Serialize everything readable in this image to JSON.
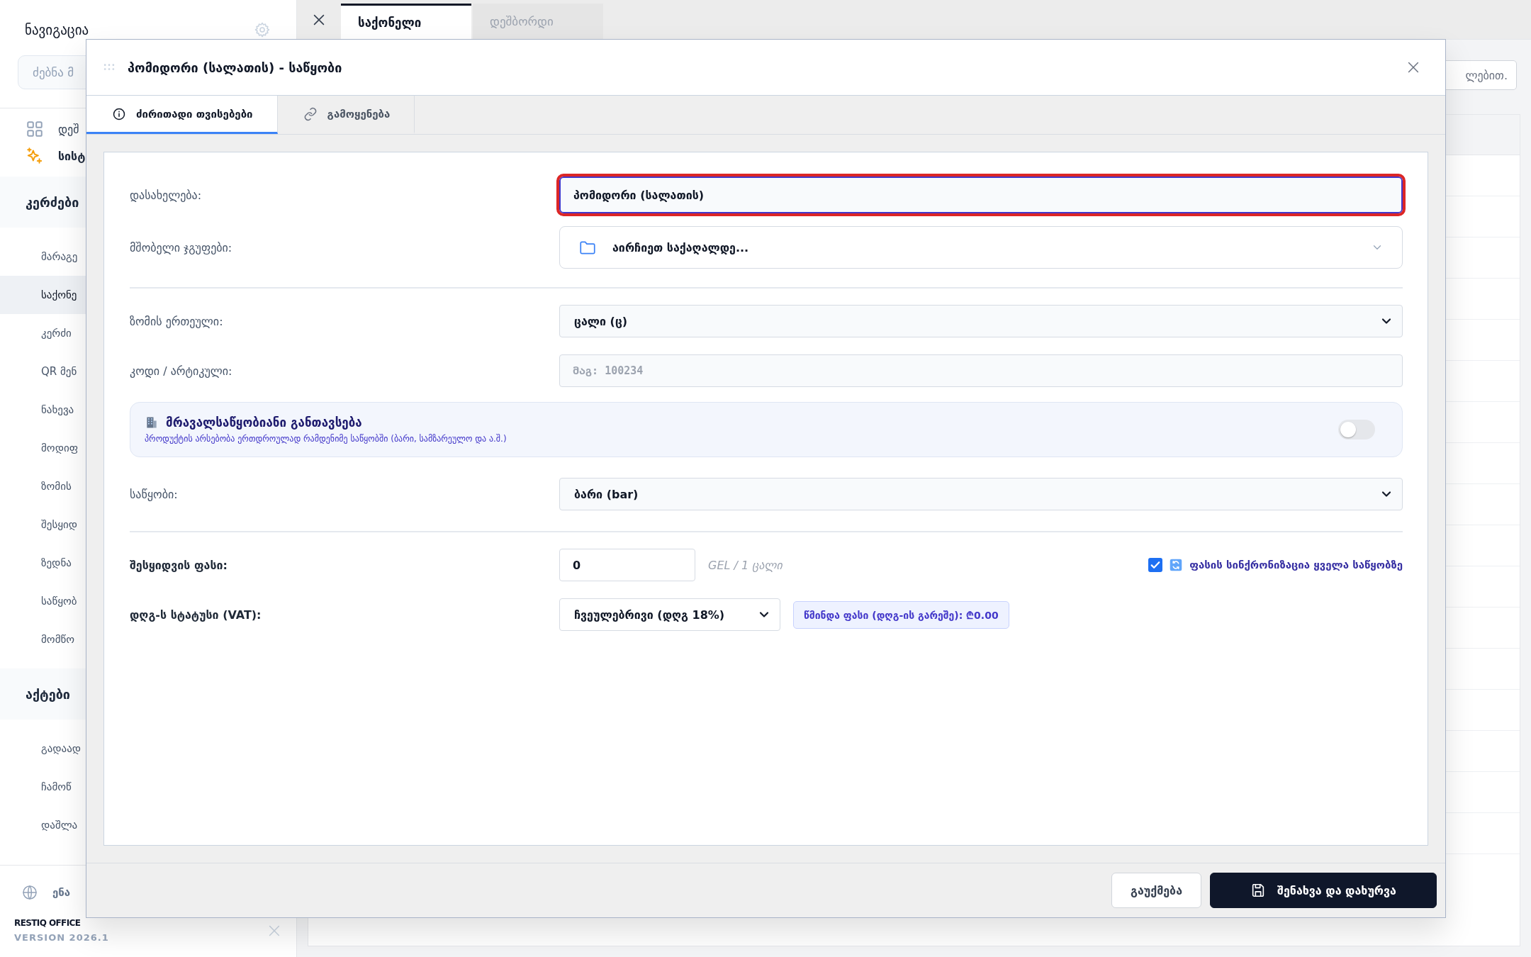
{
  "sidebar": {
    "title": "ნავიგაცია",
    "search": {
      "placeholder": "ძებნა მ"
    },
    "top_items": [
      {
        "label": "დეშ"
      },
      {
        "label": "სისტ"
      }
    ],
    "sections": [
      {
        "title": "კერძები",
        "items": [
          {
            "label": "მარაგე",
            "selected": false
          },
          {
            "label": "საქონე",
            "selected": true
          },
          {
            "label": "კერძი",
            "selected": false
          },
          {
            "label": "QR მენ",
            "selected": false
          },
          {
            "label": "ნახევა",
            "selected": false
          },
          {
            "label": "მოდიფ",
            "selected": false
          },
          {
            "label": "ზომის",
            "selected": false
          },
          {
            "label": "შესყიდ",
            "selected": false
          },
          {
            "label": "ზედნა",
            "selected": false
          },
          {
            "label": "საწყობ",
            "selected": false
          },
          {
            "label": "მომწო",
            "selected": false
          }
        ]
      },
      {
        "title": "აქტები",
        "items": [
          {
            "label": "გადაად",
            "selected": false
          },
          {
            "label": "ჩამოწ",
            "selected": false
          },
          {
            "label": "დაშლა",
            "selected": false
          }
        ]
      }
    ],
    "language": "ენა",
    "brand": "RESTIQ OFFICE",
    "version": "VERSION 2026.1"
  },
  "tabs": [
    {
      "label": "საქონელი",
      "selected": true
    },
    {
      "label": "დეშბორდი",
      "selected": false
    }
  ],
  "background_search": {
    "placeholder": "ლებით."
  },
  "modal": {
    "title": "პომიდორი (სალათის) - საწყობი",
    "tabs": [
      {
        "label": "ძირითადი თვისებები",
        "selected": true
      },
      {
        "label": "გამოყენება",
        "selected": false
      }
    ],
    "fields": [
      {
        "kind": "text",
        "label": "დასახელება:",
        "value": "პომიდორი (სალათის)",
        "focused": true
      },
      {
        "kind": "folder",
        "label": "მშობელი ჯგუფები:",
        "value": "აირჩიეთ საქაღალდე..."
      },
      {
        "kind": "divider"
      },
      {
        "kind": "select",
        "label": "ზომის ერთეული:",
        "value": "ცალი (ც)"
      },
      {
        "kind": "text",
        "label": "კოდი / არტიკული:",
        "placeholder": "მაგ: 100234",
        "focused": false
      },
      {
        "kind": "toggle_panel",
        "title": "მრავალსაწყობიანი განთავსება",
        "description": "პროდუქტის არსებობა ერთდროულად რამდენიმე საწყობში (ბარი, სამზარეულო და ა.შ.)",
        "on": false
      },
      {
        "kind": "select",
        "label": "საწყობი:",
        "value": "ბარი (bar)"
      },
      {
        "kind": "divider"
      },
      {
        "kind": "price",
        "label": "შესყიდვის ფასი:",
        "value": "0",
        "unit": "GEL / 1 ცალი",
        "sync": {
          "label": "ფასის სინქრონიზაცია ყველა საწყობზე",
          "checked": true
        }
      },
      {
        "kind": "vat",
        "label": "დღგ-ს სტატუსი (VAT):",
        "value": "ჩვეულებრივი (დღგ 18%)",
        "net": "წმინდა ფასი (დღგ-ის გარეშე): ₾0.00"
      }
    ],
    "buttons": [
      {
        "kind": "secondary",
        "label": "გაუქმება"
      },
      {
        "kind": "primary",
        "label": "შენახვა და დახურვა"
      }
    ]
  }
}
